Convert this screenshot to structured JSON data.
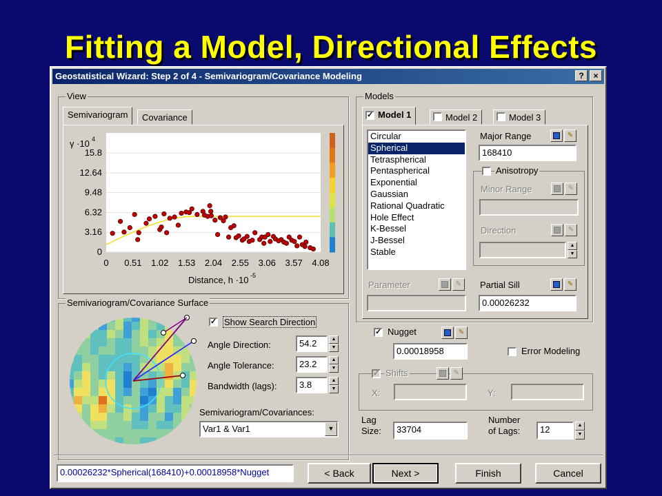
{
  "slide": {
    "title": "Fitting a Model, Directional Effects"
  },
  "window": {
    "title": "Geostatistical Wizard: Step 2 of 4 - Semivariogram/Covariance Modeling",
    "help_btn": "?",
    "close_btn": "×"
  },
  "view": {
    "group_label": "View",
    "tabs": [
      {
        "label": "Semivariogram"
      },
      {
        "label": "Covariance"
      }
    ]
  },
  "chart_data": {
    "type": "scatter",
    "ylabel_prefix": "γ ·10",
    "ylabel_exp": "4",
    "xlabel_prefix": "Distance, h ·10",
    "xlabel_exp": "-5",
    "y_ticks": [
      "0",
      "3.16",
      "6.32",
      "9.48",
      "12.64",
      "15.8"
    ],
    "x_ticks": [
      "0",
      "0.51",
      "1.02",
      "1.53",
      "2.04",
      "2.55",
      "3.06",
      "3.57",
      "4.08"
    ],
    "xlim": [
      0,
      4.08
    ],
    "ylim": [
      0,
      19
    ],
    "points": [
      [
        0.12,
        3.0
      ],
      [
        0.27,
        4.9
      ],
      [
        0.34,
        3.2
      ],
      [
        0.45,
        3.9
      ],
      [
        0.54,
        6.0
      ],
      [
        0.62,
        3.1
      ],
      [
        0.76,
        4.6
      ],
      [
        0.82,
        5.3
      ],
      [
        0.93,
        5.7
      ],
      [
        1.02,
        3.6
      ],
      [
        1.1,
        6.1
      ],
      [
        1.15,
        3.1
      ],
      [
        1.21,
        5.4
      ],
      [
        1.3,
        5.6
      ],
      [
        1.37,
        4.3
      ],
      [
        1.43,
        6.2
      ],
      [
        1.52,
        6.4
      ],
      [
        1.58,
        6.3
      ],
      [
        1.63,
        6.9
      ],
      [
        1.73,
        6.0
      ],
      [
        1.84,
        6.5
      ],
      [
        1.87,
        5.9
      ],
      [
        1.93,
        5.7
      ],
      [
        1.97,
        7.4
      ],
      [
        1.99,
        6.5
      ],
      [
        2.07,
        5.1
      ],
      [
        2.12,
        2.8
      ],
      [
        2.17,
        5.5
      ],
      [
        2.23,
        5.0
      ],
      [
        2.27,
        5.6
      ],
      [
        2.33,
        2.4
      ],
      [
        2.37,
        3.9
      ],
      [
        2.43,
        4.2
      ],
      [
        2.47,
        2.3
      ],
      [
        2.52,
        2.6
      ],
      [
        2.59,
        1.9
      ],
      [
        2.68,
        2.5
      ],
      [
        2.72,
        1.7
      ],
      [
        2.78,
        1.9
      ],
      [
        2.83,
        3.1
      ],
      [
        2.92,
        2.0
      ],
      [
        2.96,
        2.4
      ],
      [
        3.02,
        2.4
      ],
      [
        3.08,
        2.8
      ],
      [
        3.12,
        1.7
      ],
      [
        3.18,
        2.5
      ],
      [
        3.22,
        2.1
      ],
      [
        3.28,
        1.8
      ],
      [
        3.33,
        2.0
      ],
      [
        3.38,
        1.6
      ],
      [
        3.43,
        1.4
      ],
      [
        3.48,
        2.4
      ],
      [
        3.53,
        1.9
      ],
      [
        3.58,
        1.7
      ],
      [
        3.63,
        1.0
      ],
      [
        3.68,
        2.4
      ],
      [
        3.73,
        1.2
      ],
      [
        3.78,
        0.9
      ],
      [
        3.88,
        0.7
      ],
      [
        3.94,
        0.5
      ],
      [
        3.8,
        1.6
      ],
      [
        2.0,
        5.8
      ],
      [
        1.05,
        4.0
      ],
      [
        0.6,
        2.0
      ],
      [
        3.0,
        1.4
      ],
      [
        2.62,
        2.1
      ]
    ],
    "model_curve": {
      "range": 1.6841,
      "sill": 4.5,
      "nugget": 1.2
    },
    "colorbar": [
      "#d06020",
      "#e07818",
      "#f0a020",
      "#f4d030",
      "#e0e048",
      "#b8e070",
      "#60c0b0",
      "#2080d0"
    ]
  },
  "surface": {
    "group_label": "Semivariogram/Covariance Surface",
    "show_search_direction": "Show Search Direction",
    "angle_direction_label": "Angle Direction:",
    "angle_direction": "54.2",
    "angle_tolerance_label": "Angle Tolerance:",
    "angle_tolerance": "23.2",
    "bandwidth_label": "Bandwidth (lags):",
    "bandwidth": "3.8",
    "semivar_cov_label": "Semivariogram/Covariances:",
    "semivar_cov_value": "Var1 & Var1"
  },
  "models": {
    "group_label": "Models",
    "tabs": [
      {
        "label": "Model 1",
        "checked": true
      },
      {
        "label": "Model 2",
        "checked": false
      },
      {
        "label": "Model 3",
        "checked": false
      }
    ],
    "list": [
      "Circular",
      "Spherical",
      "Tetraspherical",
      "Pentaspherical",
      "Exponential",
      "Gaussian",
      "Rational Quadratic",
      "Hole Effect",
      "K-Bessel",
      "J-Bessel",
      "Stable"
    ],
    "selected": "Spherical",
    "major_range_label": "Major Range",
    "major_range": "168410",
    "anisotropy_label": "Anisotropy",
    "minor_range_label": "Minor Range",
    "direction_label": "Direction",
    "parameter_label": "Parameter",
    "partial_sill_label": "Partial Sill",
    "partial_sill": "0.00026232"
  },
  "nugget": {
    "label": "Nugget",
    "value": "0.00018958",
    "error_modeling": "Error Modeling",
    "shifts_label": "Shifts",
    "x_label": "X:",
    "y_label": "Y:"
  },
  "lag": {
    "lag_size_label_1": "Lag",
    "lag_size_label_2": "Size:",
    "lag_size": "33704",
    "num_lags_label_1": "Number",
    "num_lags_label_2": "of Lags:",
    "num_lags": "12"
  },
  "footer": {
    "formula": "0.00026232*Spherical(168410)+0.00018958*Nugget",
    "back": "< Back",
    "next": "Next >",
    "finish": "Finish",
    "cancel": "Cancel"
  },
  "colors": {
    "slide_bg": "#0a0a6e",
    "title_yellow": "#ffff00",
    "point_red": "#c00000",
    "curve_yellow": "#ffff60",
    "selection": "#0a246a"
  }
}
